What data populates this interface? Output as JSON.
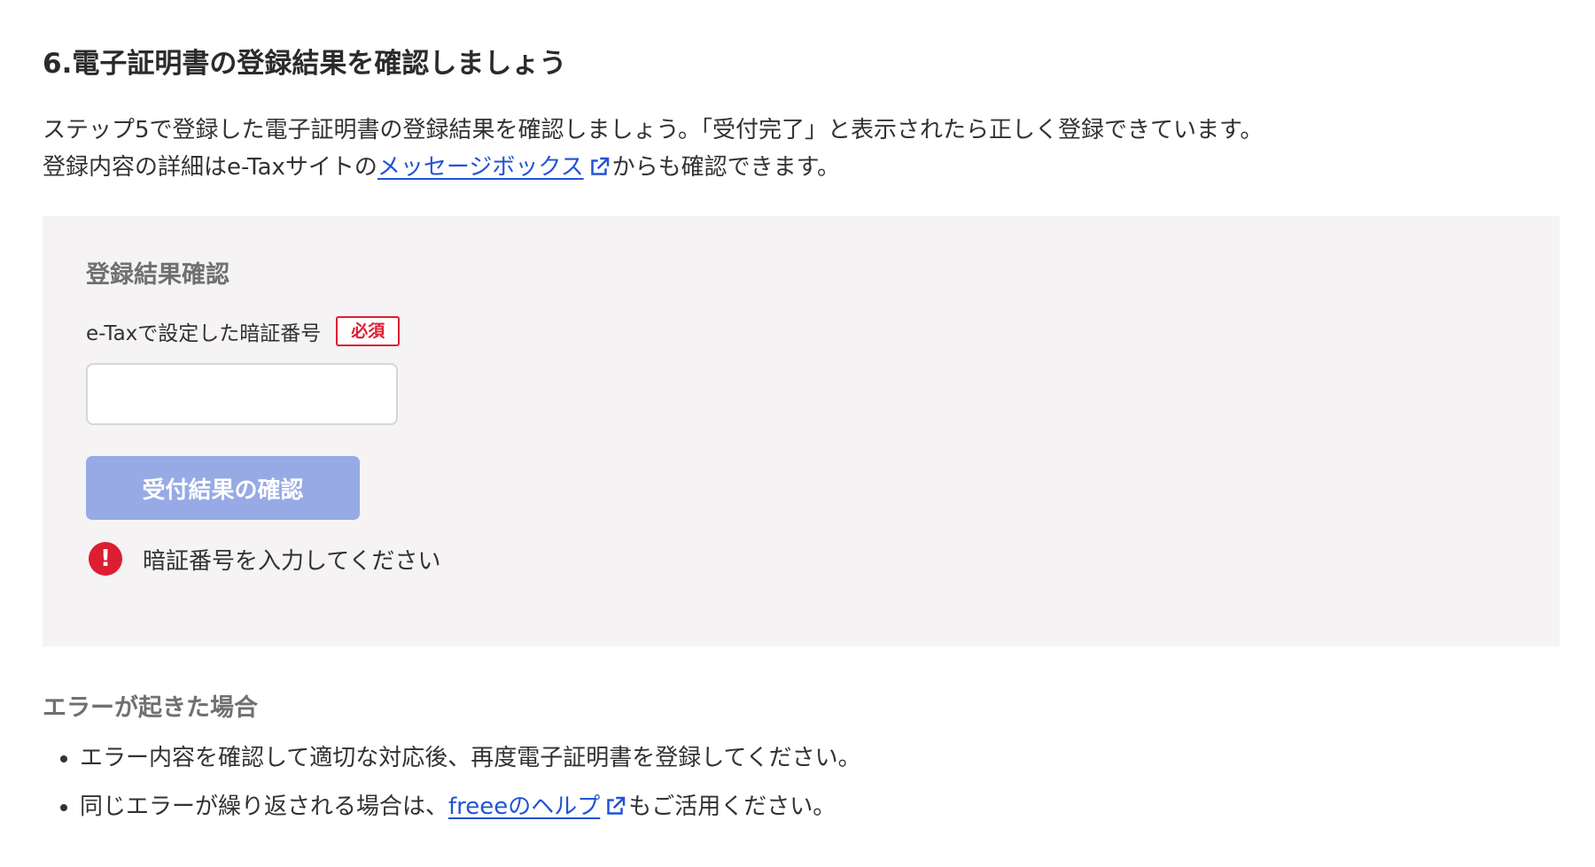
{
  "section": {
    "title": "6.電子証明書の登録結果を確認しましょう"
  },
  "description": {
    "line1": "ステップ5で登録した電子証明書の登録結果を確認しましょう。「受付完了」と表示されたら正しく登録できています。",
    "line2_before": "登録内容の詳細はe-Taxサイトの",
    "line2_link": "メッセージボックス",
    "line2_after": "からも確認できます。"
  },
  "panel": {
    "title": "登録結果確認",
    "field_label": "e-Taxで設定した暗証番号",
    "required_label": "必須",
    "input_value": "",
    "input_placeholder": "",
    "button_label": "受付結果の確認",
    "error_icon_glyph": "!",
    "error_message": "暗証番号を入力してください"
  },
  "errors_section": {
    "title": "エラーが起きた場合",
    "item1": "エラー内容を確認して適切な対応後、再度電子証明書を登録してください。",
    "item2_before": "同じエラーが繰り返される場合は、",
    "item2_link": "freeeのヘルプ",
    "item2_after": "もご活用ください。"
  },
  "icons": {
    "external_link": "external-link-icon",
    "error": "error-exclamation-icon"
  },
  "colors": {
    "link": "#2053d6",
    "required": "#dc1e32",
    "button_disabled": "#97aae6",
    "panel_bg": "#f5f3f4",
    "error": "#dc1e32"
  }
}
